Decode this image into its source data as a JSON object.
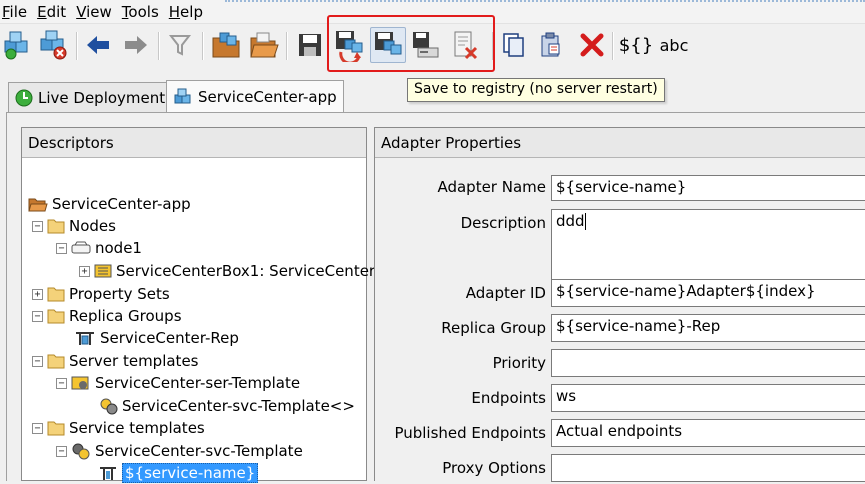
{
  "menubar": {
    "items": [
      {
        "first": "F",
        "rest": "ile"
      },
      {
        "first": "E",
        "rest": "dit"
      },
      {
        "first": "V",
        "rest": "iew"
      },
      {
        "first": "T",
        "rest": "ools"
      },
      {
        "first": "H",
        "rest": "elp"
      }
    ]
  },
  "toolbar": {
    "variable_label": "${}",
    "abc_label": "abc",
    "tooltip": "Save to registry (no server restart)"
  },
  "tabs": [
    {
      "label": "Live Deployment",
      "icon": "live-deployment-icon"
    },
    {
      "label": "ServiceCenter-app",
      "icon": "application-icon"
    }
  ],
  "left_panel": {
    "title": "Descriptors",
    "tree": [
      {
        "label": "ServiceCenter-app",
        "icon": "application-folder-icon"
      },
      {
        "label": "Nodes",
        "icon": "folder-icon"
      },
      {
        "label": "node1",
        "icon": "node-icon"
      },
      {
        "label": "ServiceCenterBox1: ServiceCenter",
        "icon": "server-icon"
      },
      {
        "label": "Property Sets",
        "icon": "folder-icon"
      },
      {
        "label": "Replica Groups",
        "icon": "folder-icon"
      },
      {
        "label": "ServiceCenter-Rep",
        "icon": "replica-group-icon"
      },
      {
        "label": "Server templates",
        "icon": "folder-icon"
      },
      {
        "label": "ServiceCenter-ser-Template",
        "icon": "server-template-icon"
      },
      {
        "label": "ServiceCenter-svc-Template<>",
        "icon": "gear-icon"
      },
      {
        "label": "Service templates",
        "icon": "folder-icon"
      },
      {
        "label": "ServiceCenter-svc-Template",
        "icon": "gear-icon"
      },
      {
        "label": "${service-name}",
        "icon": "adapter-icon"
      }
    ]
  },
  "right_panel": {
    "title": "Adapter Properties",
    "fields": [
      {
        "label": "Adapter Name",
        "value": "${service-name}"
      },
      {
        "label": "Description",
        "value": "ddd"
      },
      {
        "label": "Adapter ID",
        "value": "${service-name}Adapter${index}"
      },
      {
        "label": "Replica Group",
        "value": "${service-name}-Rep"
      },
      {
        "label": "Priority",
        "value": ""
      },
      {
        "label": "Endpoints",
        "value": "ws"
      },
      {
        "label": "Published Endpoints",
        "value": "Actual endpoints"
      },
      {
        "label": "Proxy Options",
        "value": ""
      }
    ]
  },
  "colors": {
    "highlight": "#e21b1b",
    "selection": "#3399ff",
    "tooltip_bg": "#ffffe1"
  }
}
